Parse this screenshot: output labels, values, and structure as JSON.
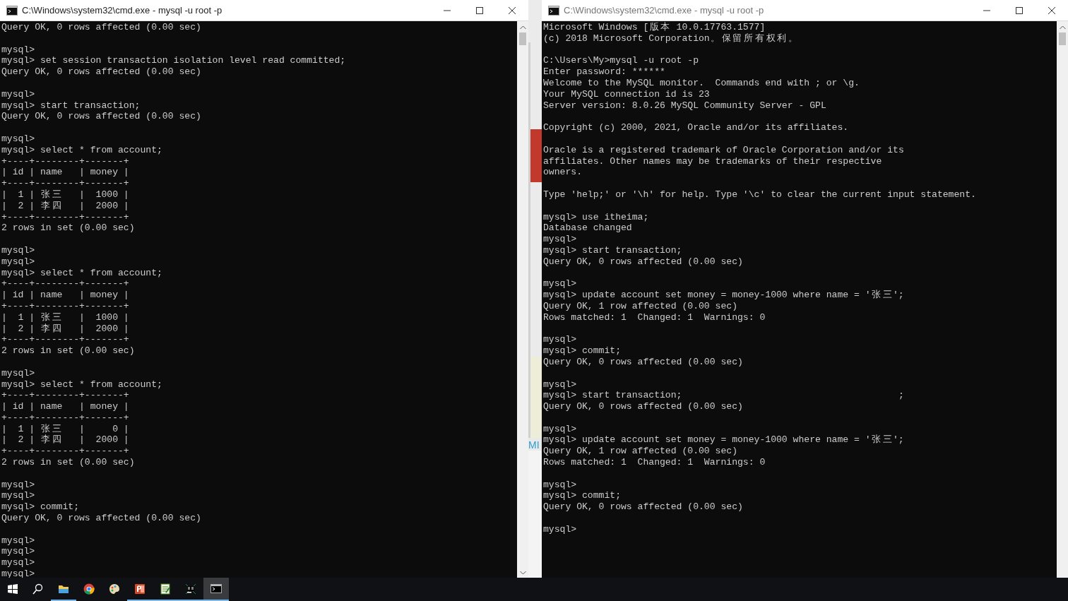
{
  "windows": [
    {
      "title": "C:\\Windows\\system32\\cmd.exe - mysql  -u root -p",
      "blocks": [
        [
          "Query OK, 0 rows affected (0.00 sec)"
        ],
        [
          "mysql>",
          "mysql> set session transaction isolation level read committed;",
          "Query OK, 0 rows affected (0.00 sec)"
        ],
        [
          "mysql>",
          "mysql> start transaction;",
          "Query OK, 0 rows affected (0.00 sec)"
        ],
        [
          "mysql>",
          "mysql> select * from account;",
          "+----+--------+-------+",
          "| id | name   | money |",
          "+----+--------+-------+",
          "|  1 | 张三   |  1000 |",
          "|  2 | 李四   |  2000 |",
          "+----+--------+-------+",
          "2 rows in set (0.00 sec)"
        ],
        [
          "mysql>",
          "mysql>",
          "mysql> select * from account;",
          "+----+--------+-------+",
          "| id | name   | money |",
          "+----+--------+-------+",
          "|  1 | 张三   |  1000 |",
          "|  2 | 李四   |  2000 |",
          "+----+--------+-------+",
          "2 rows in set (0.00 sec)"
        ],
        [
          "mysql>",
          "mysql> select * from account;",
          "+----+--------+-------+",
          "| id | name   | money |",
          "+----+--------+-------+",
          "|  1 | 张三   |     0 |",
          "|  2 | 李四   |  2000 |",
          "+----+--------+-------+",
          "2 rows in set (0.00 sec)"
        ],
        [
          "mysql>",
          "mysql>",
          "mysql> commit;",
          "Query OK, 0 rows affected (0.00 sec)"
        ],
        [
          "mysql>",
          "mysql>",
          "mysql>",
          "mysql>"
        ]
      ]
    },
    {
      "title": "C:\\Windows\\system32\\cmd.exe - mysql  -u root -p",
      "blocks": [
        [
          "Microsoft Windows [版本 10.0.17763.1577]",
          "(c) 2018 Microsoft Corporation。保留所有权利。"
        ],
        [
          "C:\\Users\\My>mysql -u root -p",
          "Enter password: ******",
          "Welcome to the MySQL monitor.  Commands end with ; or \\g.",
          "Your MySQL connection id is 23",
          "Server version: 8.0.26 MySQL Community Server - GPL"
        ],
        [
          "Copyright (c) 2000, 2021, Oracle and/or its affiliates."
        ],
        [
          "Oracle is a registered trademark of Oracle Corporation and/or its",
          "affiliates. Other names may be trademarks of their respective",
          "owners."
        ],
        [
          "Type 'help;' or '\\h' for help. Type '\\c' to clear the current input statement."
        ],
        [
          "mysql> use itheima;",
          "Database changed",
          "mysql>",
          "mysql> start transaction;",
          "Query OK, 0 rows affected (0.00 sec)"
        ],
        [
          "mysql>",
          "mysql> update account set money = money-1000 where name = '张三';",
          "Query OK, 1 row affected (0.00 sec)",
          "Rows matched: 1  Changed: 1  Warnings: 0"
        ],
        [
          "mysql>",
          "mysql> commit;",
          "Query OK, 0 rows affected (0.00 sec)"
        ],
        [
          "mysql>",
          "mysql> start transaction;                                       ;",
          "Query OK, 0 rows affected (0.00 sec)"
        ],
        [
          "mysql>",
          "mysql> update account set money = money-1000 where name = '张三';",
          "Query OK, 1 row affected (0.00 sec)",
          "Rows matched: 1  Changed: 1  Warnings: 0"
        ],
        [
          "mysql>",
          "mysql> commit;",
          "Query OK, 0 rows affected (0.00 sec)"
        ],
        [
          "mysql>"
        ]
      ]
    }
  ],
  "backdrop": {
    "text": "MI"
  },
  "taskbar": {
    "apps": [
      {
        "kind": "start",
        "running": false,
        "selected": false
      },
      {
        "kind": "search",
        "running": false,
        "selected": false
      },
      {
        "kind": "files",
        "running": true,
        "selected": false
      },
      {
        "kind": "chrome",
        "running": false,
        "selected": false
      },
      {
        "kind": "paint",
        "running": false,
        "selected": false
      },
      {
        "kind": "slides",
        "running": true,
        "selected": false
      },
      {
        "kind": "notepad",
        "running": true,
        "selected": false
      },
      {
        "kind": "datagrip",
        "running": true,
        "selected": false
      },
      {
        "kind": "console",
        "running": true,
        "selected": true
      }
    ]
  }
}
